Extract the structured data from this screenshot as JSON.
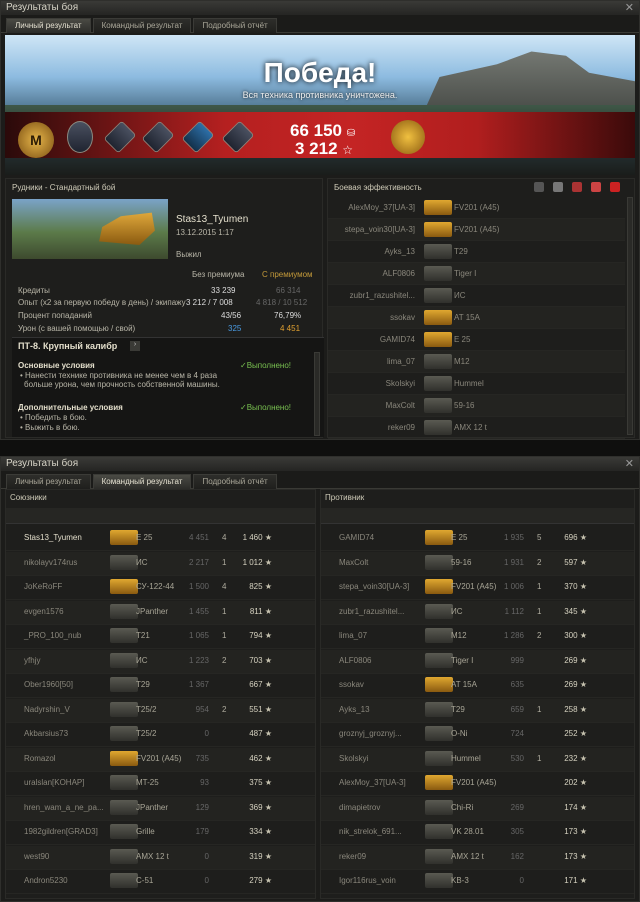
{
  "w1": {
    "title": "Результаты боя",
    "tabs": [
      "Личный результат",
      "Командный результат",
      "Подробный отчёт"
    ],
    "banner": {
      "victory": "Победа!",
      "sub": "Вся техника противника уничтожена.",
      "credits": "66 150",
      "xp": "3 212",
      "mastery": "М"
    },
    "map": "Рудники - Стандартный бой",
    "player": "Stas13_Tyumen",
    "date": "13.12.2015 1:17",
    "status": "Выжил",
    "cols": [
      "Без премиума",
      "С премиумом"
    ],
    "stats": [
      {
        "label": "Кредиты",
        "a": "33 239",
        "b": "66 314"
      },
      {
        "label": "Опыт  (x2 за первую победу в день) / экипажу",
        "a": "3 212 / 7 008",
        "b": "4 818 / 10 512"
      },
      {
        "label": "Процент попаданий",
        "a": "43/56",
        "b": "76,79%"
      },
      {
        "label": "Урон (с вашей помощью / свой)",
        "a": "325",
        "b": "4 451"
      }
    ],
    "quest": {
      "title": "ПТ-8. Крупный калибр",
      "main": "Основные условия",
      "main_status": "Выполнено!",
      "main_text1": "• Нанести технике противника не менее чем в 4 раза",
      "main_text2": "больше урона, чем прочность собственной машины.",
      "extra": "Дополнительные условия",
      "extra_status": "Выполнено!",
      "extra_1": "• Победить в бою.",
      "extra_2": "• Выжить в бою."
    },
    "eff_title": "Боевая эффективность",
    "enemies": [
      {
        "name": "AlexMoy_37[UA-3]",
        "tank": "FV201 (A45)"
      },
      {
        "name": "stepa_voin30[UA-3]",
        "tank": "FV201 (A45)"
      },
      {
        "name": "Ayks_13",
        "tank": "T29"
      },
      {
        "name": "ALF0806",
        "tank": "Tiger I"
      },
      {
        "name": "zubr1_razushitel...",
        "tank": "ИС"
      },
      {
        "name": "ssokav",
        "tank": "AT 15A"
      },
      {
        "name": "GAMID74",
        "tank": "E 25"
      },
      {
        "name": "lima_07",
        "tank": "M12"
      },
      {
        "name": "Skolskyi",
        "tank": "Hummel"
      },
      {
        "name": "MaxColt",
        "tank": "59-16"
      },
      {
        "name": "reker09",
        "tank": "AMX 12 t"
      }
    ]
  },
  "w2": {
    "title": "Результаты боя",
    "tabs": [
      "Личный результат",
      "Командный результат",
      "Подробный отчёт"
    ],
    "allies_title": "Союзники",
    "enemies_title": "Противник",
    "allies": [
      {
        "name": "Stas13_Tyumen",
        "tank": "E 25",
        "dmg": "4 451",
        "kills": "4",
        "xp": "1 460"
      },
      {
        "name": "nikolayv174rus",
        "tank": "ИС",
        "dmg": "2 217",
        "kills": "1",
        "xp": "1 012"
      },
      {
        "name": "JoKeRoFF",
        "tank": "СУ-122-44",
        "dmg": "1 500",
        "kills": "4",
        "xp": "825"
      },
      {
        "name": "evgen1576",
        "tank": "JPanther",
        "dmg": "1 455",
        "kills": "1",
        "xp": "811"
      },
      {
        "name": "_PRO_100_nub",
        "tank": "T21",
        "dmg": "1 065",
        "kills": "1",
        "xp": "794"
      },
      {
        "name": "yfhjy",
        "tank": "ИС",
        "dmg": "1 223",
        "kills": "2",
        "xp": "703"
      },
      {
        "name": "Ober1960[50]",
        "tank": "T29",
        "dmg": "1 367",
        "kills": "",
        "xp": "667"
      },
      {
        "name": "Nadyrshin_V",
        "tank": "T25/2",
        "dmg": "954",
        "kills": "2",
        "xp": "551"
      },
      {
        "name": "Akbarsius73",
        "tank": "T25/2",
        "dmg": "0",
        "kills": "",
        "xp": "487"
      },
      {
        "name": "Romazol",
        "tank": "FV201 (A45)",
        "dmg": "735",
        "kills": "",
        "xp": "462"
      },
      {
        "name": "uralslan[KOHAP]",
        "tank": "MT-25",
        "dmg": "93",
        "kills": "",
        "xp": "375"
      },
      {
        "name": "hren_wam_a_ne_pa...",
        "tank": "JPanther",
        "dmg": "129",
        "kills": "",
        "xp": "369"
      },
      {
        "name": "1982gildren[GRAD3]",
        "tank": "Grille",
        "dmg": "179",
        "kills": "",
        "xp": "334"
      },
      {
        "name": "west90",
        "tank": "AMX 12 t",
        "dmg": "0",
        "kills": "",
        "xp": "319"
      },
      {
        "name": "Andron5230",
        "tank": "С-51",
        "dmg": "0",
        "kills": "",
        "xp": "279"
      }
    ],
    "enemies": [
      {
        "name": "GAMID74",
        "tank": "E 25",
        "dmg": "1 935",
        "kills": "5",
        "xp": "696"
      },
      {
        "name": "MaxColt",
        "tank": "59-16",
        "dmg": "1 931",
        "kills": "2",
        "xp": "597"
      },
      {
        "name": "stepa_voin30[UA-3]",
        "tank": "FV201 (A45)",
        "dmg": "1 006",
        "kills": "1",
        "xp": "370"
      },
      {
        "name": "zubr1_razushitel...",
        "tank": "ИС",
        "dmg": "1 112",
        "kills": "1",
        "xp": "345"
      },
      {
        "name": "lima_07",
        "tank": "M12",
        "dmg": "1 286",
        "kills": "2",
        "xp": "300"
      },
      {
        "name": "ALF0806",
        "tank": "Tiger I",
        "dmg": "999",
        "kills": "",
        "xp": "269"
      },
      {
        "name": "ssokav",
        "tank": "AT 15A",
        "dmg": "635",
        "kills": "",
        "xp": "269"
      },
      {
        "name": "Ayks_13",
        "tank": "T29",
        "dmg": "659",
        "kills": "1",
        "xp": "258"
      },
      {
        "name": "groznyj_groznyj...",
        "tank": "O-Ni",
        "dmg": "724",
        "kills": "",
        "xp": "252"
      },
      {
        "name": "Skolskyi",
        "tank": "Hummel",
        "dmg": "530",
        "kills": "1",
        "xp": "232"
      },
      {
        "name": "AlexMoy_37[UA-3]",
        "tank": "FV201 (A45)",
        "dmg": "",
        "kills": "",
        "xp": "202"
      },
      {
        "name": "dimapietrov",
        "tank": "Chi-Ri",
        "dmg": "269",
        "kills": "",
        "xp": "174"
      },
      {
        "name": "nik_strelok_691...",
        "tank": "VK 28.01",
        "dmg": "305",
        "kills": "",
        "xp": "173"
      },
      {
        "name": "reker09",
        "tank": "AMX 12 t",
        "dmg": "162",
        "kills": "",
        "xp": "173"
      },
      {
        "name": "Igor116rus_voin",
        "tank": "KB-3",
        "dmg": "0",
        "kills": "",
        "xp": "171"
      }
    ]
  }
}
